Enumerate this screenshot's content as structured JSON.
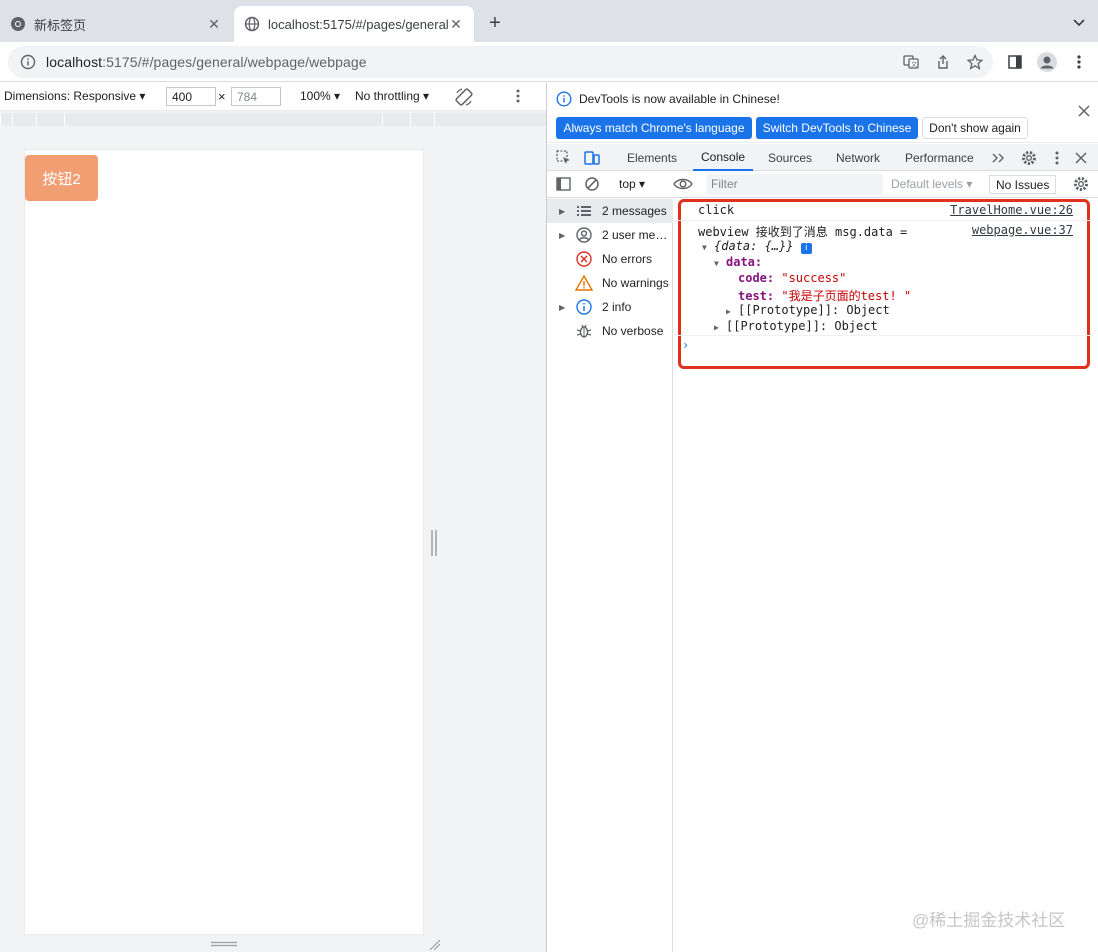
{
  "browser": {
    "tabs": [
      {
        "title": "新标签页",
        "active": false
      },
      {
        "title": "localhost:5175/#/pages/general/webpage/webpage",
        "active": true
      }
    ],
    "url_host": "localhost",
    "url_rest": ":5175/#/pages/general/webpage/webpage"
  },
  "device_toolbar": {
    "dimensions_label": "Dimensions: Responsive ▾",
    "width": "400",
    "times": "×",
    "height": "784",
    "zoom": "100% ▾",
    "throttling": "No throttling ▾"
  },
  "page": {
    "button2_label": "按钮2"
  },
  "devtools": {
    "infobar": {
      "message": "DevTools is now available in Chinese!",
      "btn_match": "Always match Chrome's language",
      "btn_switch": "Switch DevTools to Chinese",
      "btn_dismiss": "Don't show again"
    },
    "panels": [
      "Elements",
      "Console",
      "Sources",
      "Network",
      "Performance"
    ],
    "active_panel": "Console",
    "console_bar": {
      "context": "top ▾",
      "filter_placeholder": "Filter",
      "levels": "Default levels ▾",
      "issues": "No Issues"
    },
    "sidebar": [
      {
        "label": "2 messages",
        "icon": "list-icon",
        "expandable": true,
        "selected": true
      },
      {
        "label": "2 user me…",
        "icon": "user-icon",
        "expandable": true,
        "selected": false
      },
      {
        "label": "No errors",
        "icon": "error-icon",
        "expandable": false,
        "selected": false
      },
      {
        "label": "No warnings",
        "icon": "warning-icon",
        "expandable": false,
        "selected": false
      },
      {
        "label": "2 info",
        "icon": "info-icon",
        "expandable": true,
        "selected": false
      },
      {
        "label": "No verbose",
        "icon": "bug-icon",
        "expandable": false,
        "selected": false
      }
    ],
    "console_lines": {
      "line1_text": "click",
      "line1_src": "TravelHome.vue:26",
      "line2_text": "webview 接收到了消息 msg.data =",
      "line2_src": "webpage.vue:37",
      "obj_summary": "{data: {…}}",
      "data_key": "data:",
      "code_key": "code:",
      "code_val": "\"success\"",
      "test_key": "test:",
      "test_val": "\"我是子页面的test! \"",
      "proto_inner": "[[Prototype]]: Object",
      "proto_outer": "[[Prototype]]: Object"
    }
  },
  "watermark": "@稀土掘金技术社区",
  "colors": {
    "highlight_border": "#e0311c",
    "button2_bg": "#f19e72",
    "devtools_blue": "#1a73e8"
  }
}
